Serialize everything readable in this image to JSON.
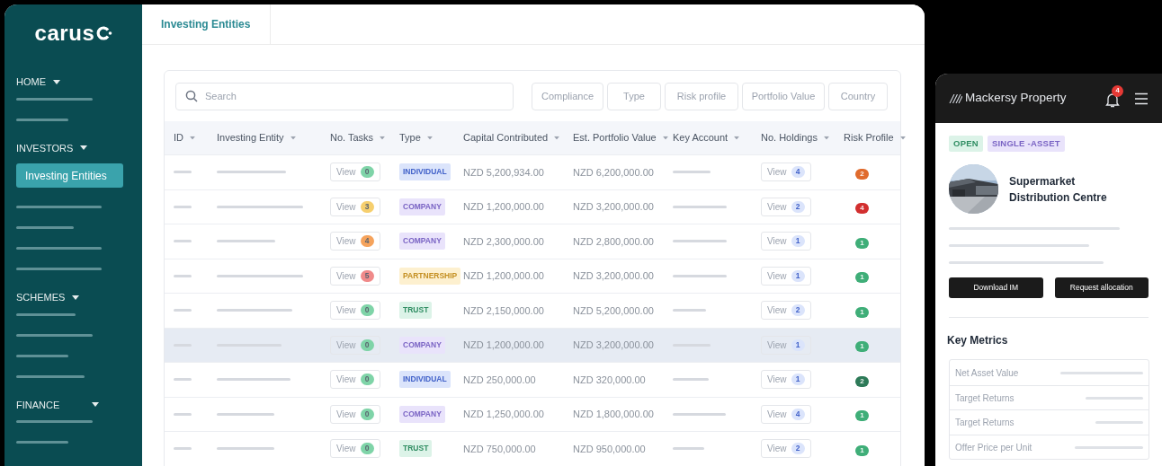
{
  "logo": {
    "text": "carus"
  },
  "nav": [
    {
      "label": "HOME",
      "expanded": true,
      "items": [
        {
          "kind": "placeholder"
        },
        {
          "kind": "placeholder"
        }
      ]
    },
    {
      "label": "INVESTORS",
      "expanded": true,
      "items": [
        {
          "kind": "link",
          "label": "Investing Entities",
          "selected": true
        },
        {
          "kind": "placeholder"
        },
        {
          "kind": "placeholder"
        },
        {
          "kind": "placeholder"
        },
        {
          "kind": "placeholder"
        }
      ]
    },
    {
      "label": "SCHEMES",
      "expanded": true,
      "items": [
        {
          "kind": "placeholder"
        },
        {
          "kind": "placeholder"
        },
        {
          "kind": "placeholder"
        },
        {
          "kind": "placeholder"
        }
      ]
    },
    {
      "label": "FINANCE",
      "expanded": true,
      "items": [
        {
          "kind": "placeholder"
        },
        {
          "kind": "placeholder"
        }
      ]
    }
  ],
  "tabs": [
    {
      "label": "Investing Entities",
      "selected": true
    }
  ],
  "search": {
    "placeholder": "Search"
  },
  "filters": [
    "Compliance",
    "Type",
    "Risk profile",
    "Portfolio Value",
    "Country"
  ],
  "table": {
    "columns": [
      "ID",
      "Investing Entity",
      "No. Tasks",
      "Type",
      "Capital Contributed",
      "Est. Portfolio Value",
      "Key Account",
      "No. Holdings",
      "Risk Profile"
    ],
    "rows": [
      {
        "selected": false,
        "tasks": {
          "label": "View",
          "count": "0",
          "color": "#7fd4a8"
        },
        "type": {
          "label": "INDIVIDUAL",
          "color": "#dbe4fb"
        },
        "capital": "NZD 5,200,934.00",
        "portfolio": "NZD 6,200,000.00",
        "holdings": {
          "label": "View",
          "count": "4"
        },
        "risk": {
          "value": "2",
          "color": "#e06b2d"
        }
      },
      {
        "selected": false,
        "tasks": {
          "label": "View",
          "count": "3",
          "color": "#f6cf6e"
        },
        "type": {
          "label": "COMPANY",
          "color": "#e9e3fb"
        },
        "capital": "NZD 1,200,000.00",
        "portfolio": "NZD 3,200,000.00",
        "holdings": {
          "label": "View",
          "count": "2"
        },
        "risk": {
          "value": "4",
          "color": "#d22f2f"
        }
      },
      {
        "selected": false,
        "tasks": {
          "label": "View",
          "count": "4",
          "color": "#f5a35c"
        },
        "type": {
          "label": "COMPANY",
          "color": "#e9e3fb"
        },
        "capital": "NZD 2,300,000.00",
        "portfolio": "NZD 2,800,000.00",
        "holdings": {
          "label": "View",
          "count": "1"
        },
        "risk": {
          "value": "1",
          "color": "#3fae78"
        }
      },
      {
        "selected": false,
        "tasks": {
          "label": "View",
          "count": "5",
          "color": "#f08a8a"
        },
        "type": {
          "label": "PARTNERSHIP",
          "color": "#fdf0cf"
        },
        "capital": "NZD 1,200,000.00",
        "portfolio": "NZD 3,200,000.00",
        "holdings": {
          "label": "View",
          "count": "1"
        },
        "risk": {
          "value": "1",
          "color": "#3fae78"
        }
      },
      {
        "selected": false,
        "tasks": {
          "label": "View",
          "count": "0",
          "color": "#7fd4a8"
        },
        "type": {
          "label": "TRUST",
          "color": "#dcf3e8"
        },
        "capital": "NZD 2,150,000.00",
        "portfolio": "NZD 5,200,000.00",
        "holdings": {
          "label": "View",
          "count": "2"
        },
        "risk": {
          "value": "1",
          "color": "#3fae78"
        }
      },
      {
        "selected": true,
        "tasks": {
          "label": "View",
          "count": "0",
          "color": "#7fd4a8"
        },
        "type": {
          "label": "COMPANY",
          "color": "#e9e3fb"
        },
        "capital": "NZD 1,200,000.00",
        "portfolio": "NZD 3,200,000.00",
        "holdings": {
          "label": "View",
          "count": "1"
        },
        "risk": {
          "value": "1",
          "color": "#3fae78"
        }
      },
      {
        "selected": false,
        "tasks": {
          "label": "View",
          "count": "0",
          "color": "#7fd4a8"
        },
        "type": {
          "label": "INDIVIDUAL",
          "color": "#dbe4fb"
        },
        "capital": "NZD 250,000.00",
        "portfolio": "NZD 320,000.00",
        "holdings": {
          "label": "View",
          "count": "1"
        },
        "risk": {
          "value": "2",
          "color": "#2d7a58"
        }
      },
      {
        "selected": false,
        "tasks": {
          "label": "View",
          "count": "0",
          "color": "#7fd4a8"
        },
        "type": {
          "label": "COMPANY",
          "color": "#e9e3fb"
        },
        "capital": "NZD 1,250,000.00",
        "portfolio": "NZD 1,800,000.00",
        "holdings": {
          "label": "View",
          "count": "4"
        },
        "risk": {
          "value": "1",
          "color": "#3fae78"
        }
      },
      {
        "selected": false,
        "tasks": {
          "label": "View",
          "count": "0",
          "color": "#7fd4a8"
        },
        "type": {
          "label": "TRUST",
          "color": "#dcf3e8"
        },
        "capital": "NZD 750,000.00",
        "portfolio": "NZD 950,000.00",
        "holdings": {
          "label": "View",
          "count": "2"
        },
        "risk": {
          "value": "1",
          "color": "#3fae78"
        }
      }
    ]
  },
  "mobile": {
    "brand": "Mackersy Property",
    "notifications": "4",
    "tags": [
      {
        "label": "OPEN",
        "color": "#dcf3e8"
      },
      {
        "label": "SINGLE -ASSET",
        "color": "#e9e3fb"
      }
    ],
    "property": {
      "title": "Supermarket Distribution Centre"
    },
    "buttons": [
      "Download IM",
      "Request allocation"
    ],
    "metrics_title": "Key Metrics",
    "metrics": [
      "Net Asset Value",
      "Target Returns",
      "Target Returns",
      "Offer Price per Unit"
    ]
  }
}
